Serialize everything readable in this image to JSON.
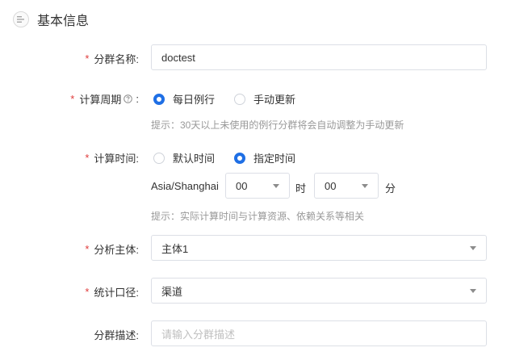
{
  "section": {
    "title": "基本信息",
    "icon": "list-lines-icon"
  },
  "form": {
    "name": {
      "required_mark": "*",
      "label": "分群名称:",
      "value": "doctest"
    },
    "cycle": {
      "required_mark": "*",
      "label": "计算周期",
      "suffix": ":",
      "options": [
        {
          "label": "每日例行",
          "checked": true
        },
        {
          "label": "手动更新",
          "checked": false
        }
      ],
      "hint": "提示：30天以上未使用的例行分群将会自动调整为手动更新"
    },
    "time": {
      "required_mark": "*",
      "label": "计算时间:",
      "options": [
        {
          "label": "默认时间",
          "checked": false
        },
        {
          "label": "指定时间",
          "checked": true
        }
      ],
      "timezone": "Asia/Shanghai",
      "hour": "00",
      "hour_unit": "时",
      "minute": "00",
      "minute_unit": "分",
      "hint": "提示：实际计算时间与计算资源、依赖关系等相关"
    },
    "subject": {
      "required_mark": "*",
      "label": "分析主体:",
      "value": "主体1"
    },
    "caliber": {
      "required_mark": "*",
      "label": "统计口径:",
      "value": "渠道"
    },
    "desc": {
      "label": "分群描述:",
      "placeholder": "请输入分群描述"
    }
  },
  "colors": {
    "accent": "#1f6fe5",
    "required": "#e03c3c",
    "hint": "#999999"
  }
}
